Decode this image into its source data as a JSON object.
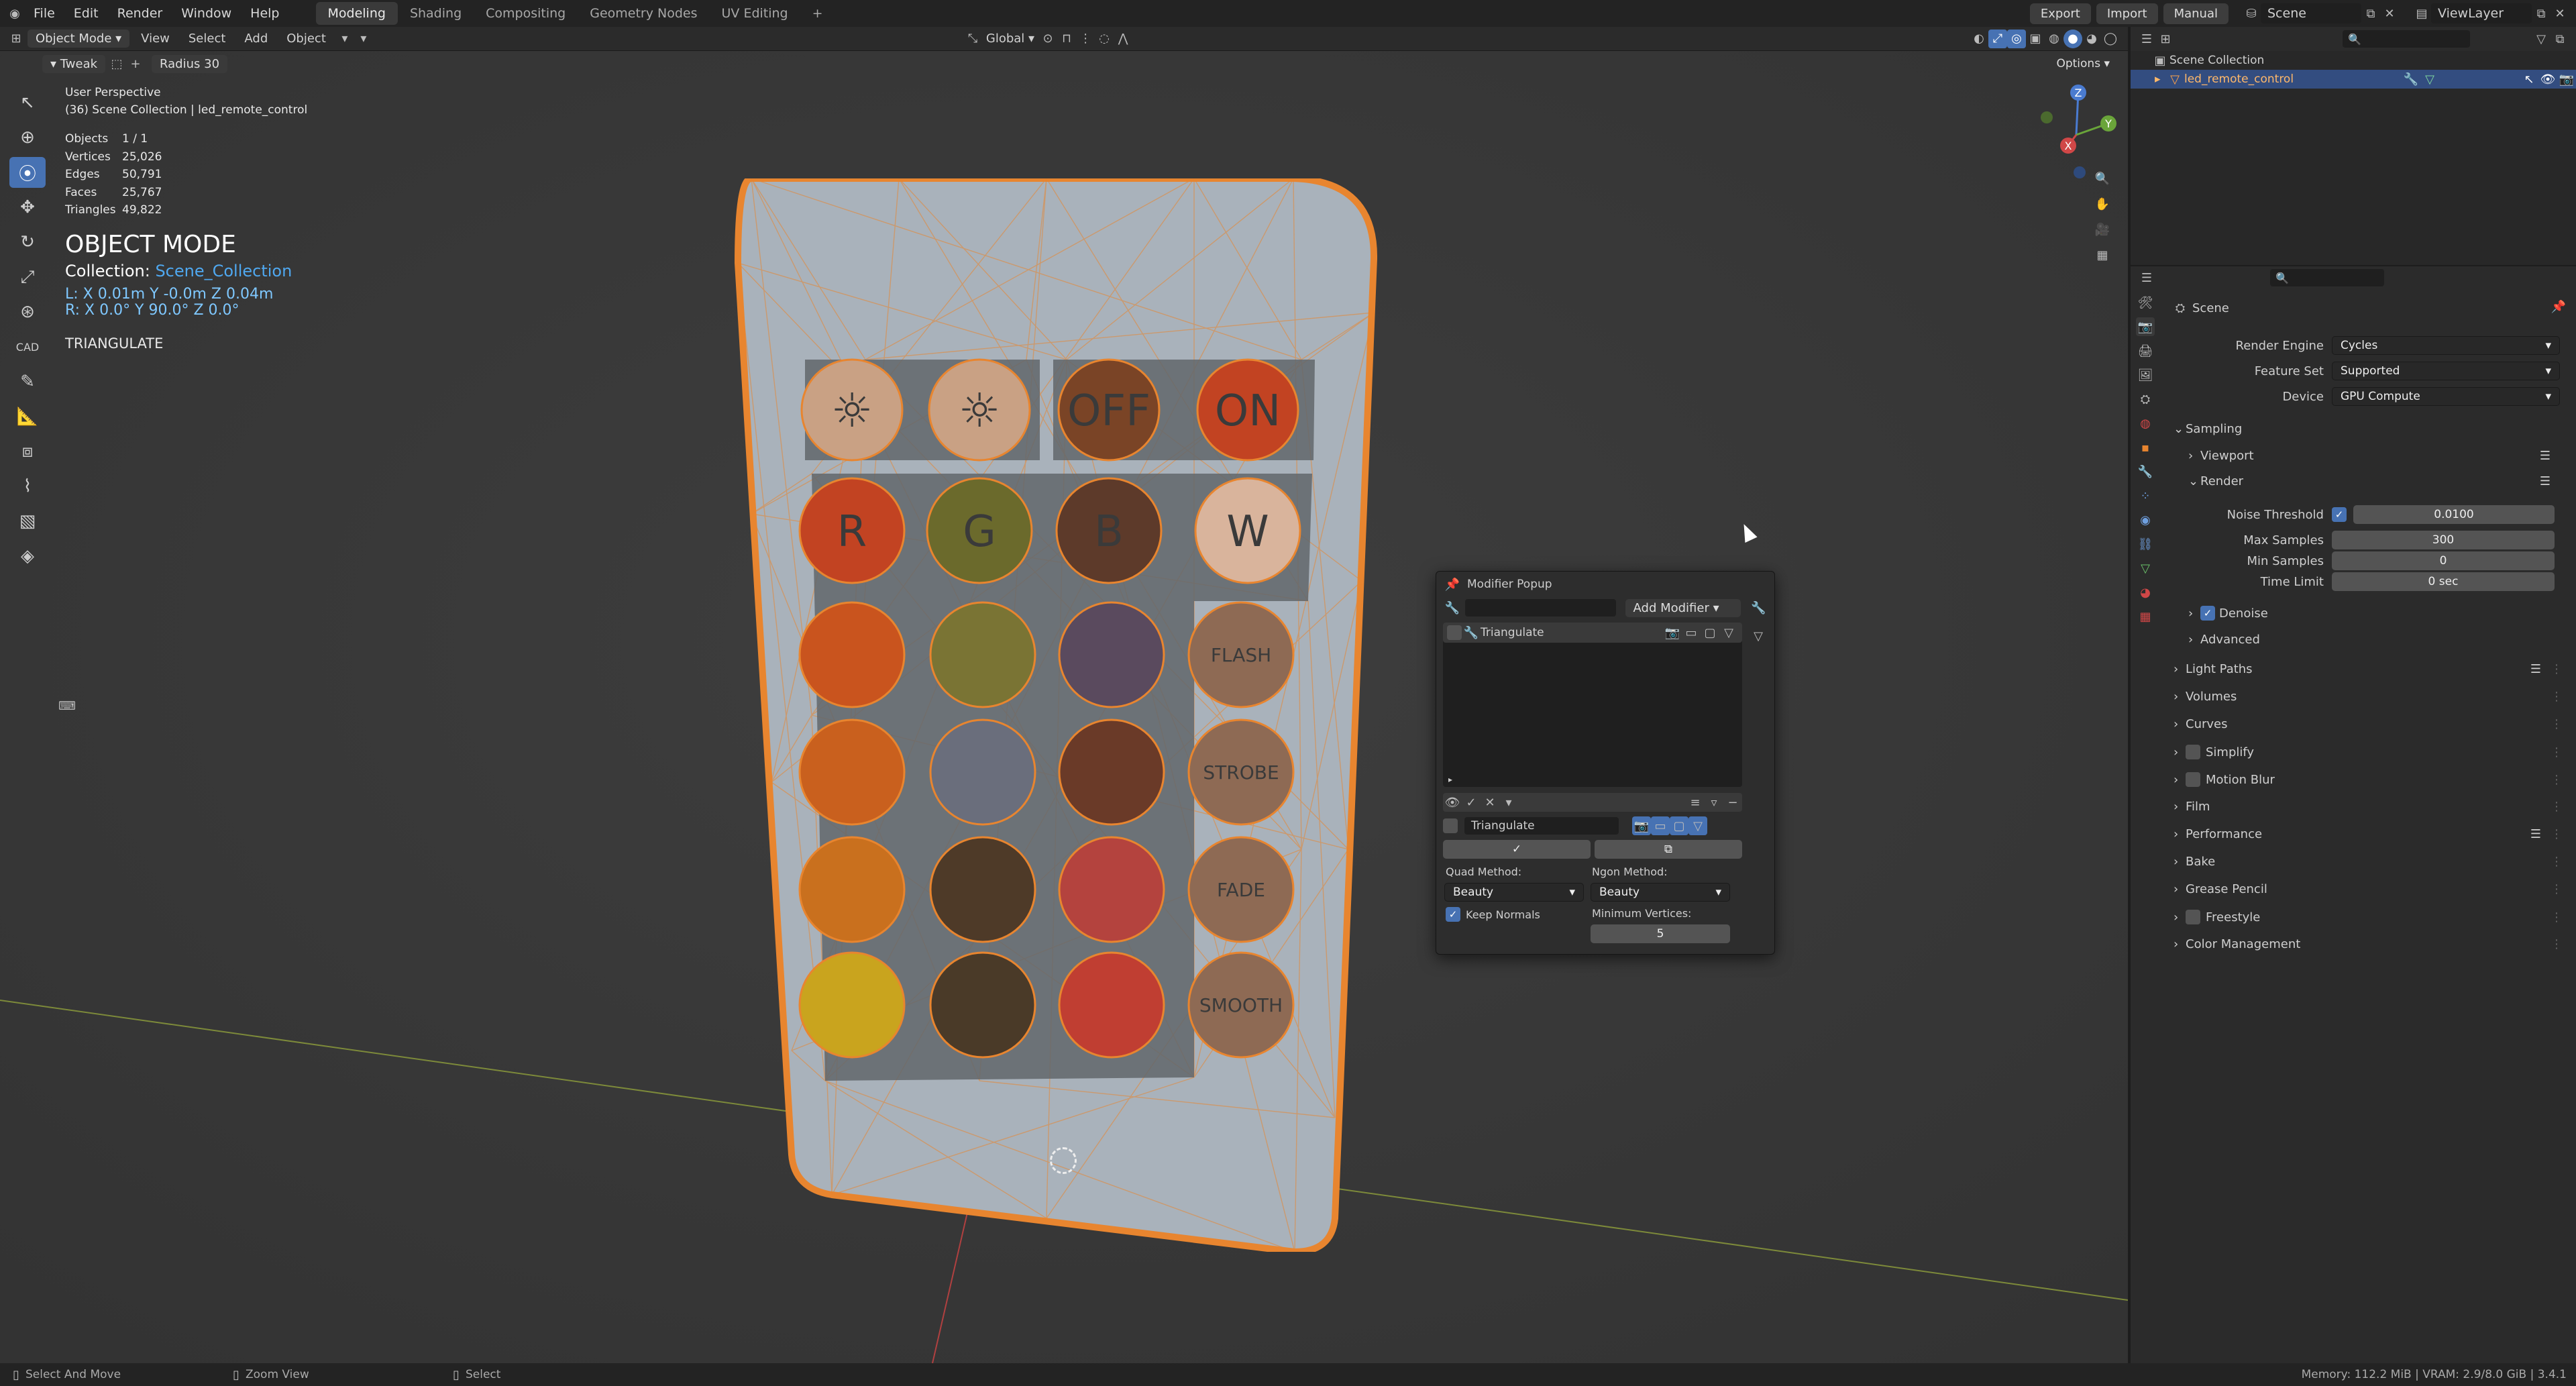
{
  "topbar": {
    "menus": [
      "File",
      "Edit",
      "Render",
      "Window",
      "Help"
    ],
    "workspaces": [
      "Modeling",
      "Shading",
      "Compositing",
      "Geometry Nodes",
      "UV Editing"
    ],
    "active_workspace": "Modeling",
    "add_label": "+",
    "export_label": "Export",
    "import_label": "Import",
    "manual_label": "Manual",
    "scene_label": "Scene",
    "viewlayer_label": "ViewLayer"
  },
  "header": {
    "mode": "Object Mode",
    "menus": [
      "View",
      "Select",
      "Add",
      "Object"
    ],
    "orientation": "Global",
    "options_label": "Options"
  },
  "toolsettings": {
    "tweak_label": "Tweak",
    "radius_label": "Radius",
    "radius_value": "30"
  },
  "viewport": {
    "perspective": "User Perspective",
    "collection_path": "(36) Scene Collection | led_remote_control",
    "stats": [
      {
        "label": "Objects",
        "value": "1 / 1"
      },
      {
        "label": "Vertices",
        "value": "25,026"
      },
      {
        "label": "Edges",
        "value": "50,791"
      },
      {
        "label": "Faces",
        "value": "25,767"
      },
      {
        "label": "Triangles",
        "value": "49,822"
      }
    ],
    "mode_title": "OBJECT MODE",
    "collection_label": "Collection:",
    "collection_name": "Scene_Collection",
    "location": "L:  X 0.01m  Y -0.0m  Z 0.04m",
    "rotation": "R:  X 0.0°  Y 90.0°  Z 0.0°",
    "operator": "TRIANGULATE",
    "gizmo": {
      "z": "Z",
      "y": "Y",
      "x": "X"
    }
  },
  "remote": {
    "row1": [
      "☼",
      "☼",
      "OFF",
      "ON"
    ],
    "row2": [
      "R",
      "G",
      "B",
      "W"
    ],
    "side": [
      "FLASH",
      "STROBE",
      "FADE",
      "SMOOTH"
    ],
    "colors": {
      "row1": [
        "#c9a184",
        "#c9a184",
        "#7a4426",
        "#c24322"
      ],
      "row2": [
        "#c24322",
        "#6b6a2c",
        "#5d3a2a",
        "#d9b49c"
      ],
      "grid": [
        [
          "#c9541e",
          "#7a7434",
          "#5a4a5e"
        ],
        [
          "#c9601e",
          "#6a6e7c",
          "#6a3a28"
        ],
        [
          "#c9701e",
          "#4e3a28",
          "#b4433e"
        ],
        [
          "#c9a41e",
          "#4a3a28",
          "#c03e32"
        ]
      ],
      "side": "#8e6a54",
      "body": "#a9b2bb",
      "outline": "#e8852f"
    }
  },
  "popup": {
    "title": "Modifier Popup",
    "add_modifier": "Add Modifier",
    "list_item": "Triangulate",
    "modifier_name": "Triangulate",
    "quad_method_label": "Quad Method:",
    "quad_method_value": "Beauty",
    "ngon_method_label": "Ngon Method:",
    "ngon_method_value": "Beauty",
    "keep_normals_label": "Keep Normals",
    "min_vertices_label": "Minimum Vertices:",
    "min_vertices_value": "5"
  },
  "outliner": {
    "root": "Scene Collection",
    "item": "led_remote_control"
  },
  "properties": {
    "title": "Scene",
    "render_engine_label": "Render Engine",
    "render_engine_value": "Cycles",
    "feature_set_label": "Feature Set",
    "feature_set_value": "Supported",
    "device_label": "Device",
    "device_value": "GPU Compute",
    "sampling": "Sampling",
    "viewport": "Viewport",
    "render": "Render",
    "noise_threshold_label": "Noise Threshold",
    "noise_threshold_value": "0.0100",
    "max_samples_label": "Max Samples",
    "max_samples_value": "300",
    "min_samples_label": "Min Samples",
    "min_samples_value": "0",
    "time_limit_label": "Time Limit",
    "time_limit_value": "0 sec",
    "denoise": "Denoise",
    "advanced": "Advanced",
    "panels": [
      "Light Paths",
      "Volumes",
      "Curves",
      "Simplify",
      "Motion Blur",
      "Film",
      "Performance",
      "Bake",
      "Grease Pencil",
      "Freestyle",
      "Color Management"
    ]
  },
  "status": {
    "left1": "Select And Move",
    "left2": "Zoom View",
    "left3": "Select",
    "right": "Memory: 112.2 MiB | VRAM: 2.9/8.0 GiB | 3.4.1"
  }
}
